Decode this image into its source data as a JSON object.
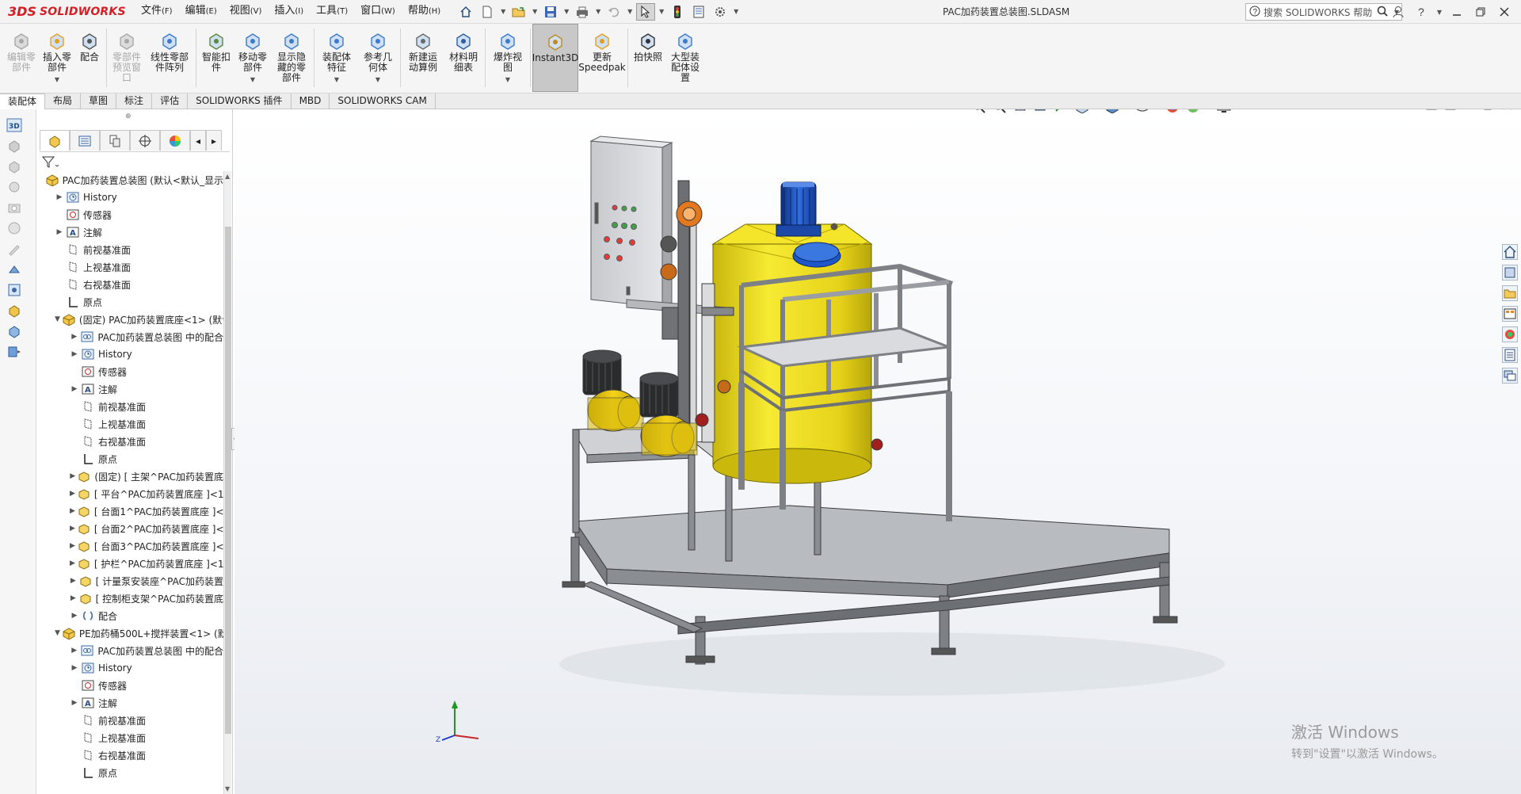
{
  "app": {
    "brand_prefix": "3DS",
    "brand": "SOLIDWORKS",
    "document_title": "PAC加药装置总装图.SLDASM",
    "search_placeholder": "搜索 SOLIDWORKS 帮助"
  },
  "menu": [
    {
      "label": "文件",
      "accel": "(F)"
    },
    {
      "label": "编辑",
      "accel": "(E)"
    },
    {
      "label": "视图",
      "accel": "(V)"
    },
    {
      "label": "插入",
      "accel": "(I)"
    },
    {
      "label": "工具",
      "accel": "(T)"
    },
    {
      "label": "窗口",
      "accel": "(W)"
    },
    {
      "label": "帮助",
      "accel": "(H)"
    }
  ],
  "ribbon": {
    "buttons": [
      {
        "label": "编辑零\n部件",
        "disabled": true
      },
      {
        "label": "插入零\n部件",
        "disabled": false
      },
      {
        "label": "配合",
        "disabled": false
      },
      {
        "label": "零部件\n预览窗\n口",
        "disabled": true
      },
      {
        "label": "线性零部\n件阵列",
        "disabled": false
      },
      {
        "label": "智能扣\n件",
        "disabled": false
      },
      {
        "label": "移动零\n部件",
        "disabled": false
      },
      {
        "label": "显示隐\n藏的零\n部件",
        "disabled": false
      },
      {
        "label": "装配体\n特征",
        "disabled": false
      },
      {
        "label": "参考几\n何体",
        "disabled": false
      },
      {
        "label": "新建运\n动算例",
        "disabled": false
      },
      {
        "label": "材料明\n细表",
        "disabled": false
      },
      {
        "label": "爆炸视\n图",
        "disabled": false
      },
      {
        "label": "Instant3D",
        "disabled": false,
        "active": true
      },
      {
        "label": "更新\nSpeedpak",
        "disabled": false
      },
      {
        "label": "拍快照",
        "disabled": false
      },
      {
        "label": "大型装\n配体设\n置",
        "disabled": false
      }
    ]
  },
  "tabs": [
    "装配体",
    "布局",
    "草图",
    "标注",
    "评估",
    "SOLIDWORKS 插件",
    "MBD",
    "SOLIDWORKS CAM"
  ],
  "active_tab": "装配体",
  "tree": [
    {
      "depth": 0,
      "exp": "",
      "icon": "assembly-icon",
      "label": "PAC加药装置总装图 (默认<默认_显示"
    },
    {
      "depth": 1,
      "exp": "›",
      "icon": "history-icon",
      "label": "History"
    },
    {
      "depth": 1,
      "exp": "",
      "icon": "sensor-icon",
      "label": "传感器"
    },
    {
      "depth": 1,
      "exp": "›",
      "icon": "annotation-icon",
      "label": "注解"
    },
    {
      "depth": 1,
      "exp": "",
      "icon": "plane-icon",
      "label": "前视基准面"
    },
    {
      "depth": 1,
      "exp": "",
      "icon": "plane-icon",
      "label": "上视基准面"
    },
    {
      "depth": 1,
      "exp": "",
      "icon": "plane-icon",
      "label": "右视基准面"
    },
    {
      "depth": 1,
      "exp": "",
      "icon": "origin-icon",
      "label": "原点"
    },
    {
      "depth": 1,
      "exp": "⌄",
      "icon": "subassembly-icon",
      "label": "(固定) PAC加药装置底座<1> (默认"
    },
    {
      "depth": 2,
      "exp": "›",
      "icon": "mates-folder-icon",
      "label": "PAC加药装置总装图 中的配合"
    },
    {
      "depth": 2,
      "exp": "›",
      "icon": "history-icon",
      "label": "History"
    },
    {
      "depth": 2,
      "exp": "",
      "icon": "sensor-icon",
      "label": "传感器"
    },
    {
      "depth": 2,
      "exp": "›",
      "icon": "annotation-icon",
      "label": "注解"
    },
    {
      "depth": 2,
      "exp": "",
      "icon": "plane-icon",
      "label": "前视基准面"
    },
    {
      "depth": 2,
      "exp": "",
      "icon": "plane-icon",
      "label": "上视基准面"
    },
    {
      "depth": 2,
      "exp": "",
      "icon": "plane-icon",
      "label": "右视基准面"
    },
    {
      "depth": 2,
      "exp": "",
      "icon": "origin-icon",
      "label": "原点"
    },
    {
      "depth": 2,
      "exp": "›",
      "icon": "part-icon",
      "label": "(固定) [ 主架^PAC加药装置底"
    },
    {
      "depth": 2,
      "exp": "›",
      "icon": "part-icon",
      "label": "[ 平台^PAC加药装置底座 ]<1"
    },
    {
      "depth": 2,
      "exp": "›",
      "icon": "part-icon",
      "label": "[ 台面1^PAC加药装置底座 ]<"
    },
    {
      "depth": 2,
      "exp": "›",
      "icon": "part-icon",
      "label": "[ 台面2^PAC加药装置底座 ]<"
    },
    {
      "depth": 2,
      "exp": "›",
      "icon": "part-icon",
      "label": "[ 台面3^PAC加药装置底座 ]<"
    },
    {
      "depth": 2,
      "exp": "›",
      "icon": "part-icon",
      "label": "[ 护栏^PAC加药装置底座 ]<1"
    },
    {
      "depth": 2,
      "exp": "›",
      "icon": "part-icon",
      "label": "[ 计量泵安装座^PAC加药装置"
    },
    {
      "depth": 2,
      "exp": "›",
      "icon": "part-icon",
      "label": "[ 控制柜支架^PAC加药装置底"
    },
    {
      "depth": 2,
      "exp": "›",
      "icon": "mates-icon",
      "label": "配合"
    },
    {
      "depth": 1,
      "exp": "⌄",
      "icon": "subassembly-icon",
      "label": "PE加药桶500L+搅拌装置<1> (默认"
    },
    {
      "depth": 2,
      "exp": "›",
      "icon": "mates-folder-icon",
      "label": "PAC加药装置总装图 中的配合"
    },
    {
      "depth": 2,
      "exp": "›",
      "icon": "history-icon",
      "label": "History"
    },
    {
      "depth": 2,
      "exp": "",
      "icon": "sensor-icon",
      "label": "传感器"
    },
    {
      "depth": 2,
      "exp": "›",
      "icon": "annotation-icon",
      "label": "注解"
    },
    {
      "depth": 2,
      "exp": "",
      "icon": "plane-icon",
      "label": "前视基准面"
    },
    {
      "depth": 2,
      "exp": "",
      "icon": "plane-icon",
      "label": "上视基准面"
    },
    {
      "depth": 2,
      "exp": "",
      "icon": "plane-icon",
      "label": "右视基准面"
    },
    {
      "depth": 2,
      "exp": "",
      "icon": "origin-icon",
      "label": "原点"
    }
  ],
  "triad": {
    "x": "",
    "y": "",
    "z": "Z"
  },
  "watermark": {
    "line1": "激活 Windows",
    "line2": "转到\"设置\"以激活 Windows。"
  },
  "colors": {
    "accent": "#d41f26",
    "tank_yellow": "#f2e21a",
    "motor_blue": "#1e57c8",
    "frame_gray": "#8a8d92"
  }
}
